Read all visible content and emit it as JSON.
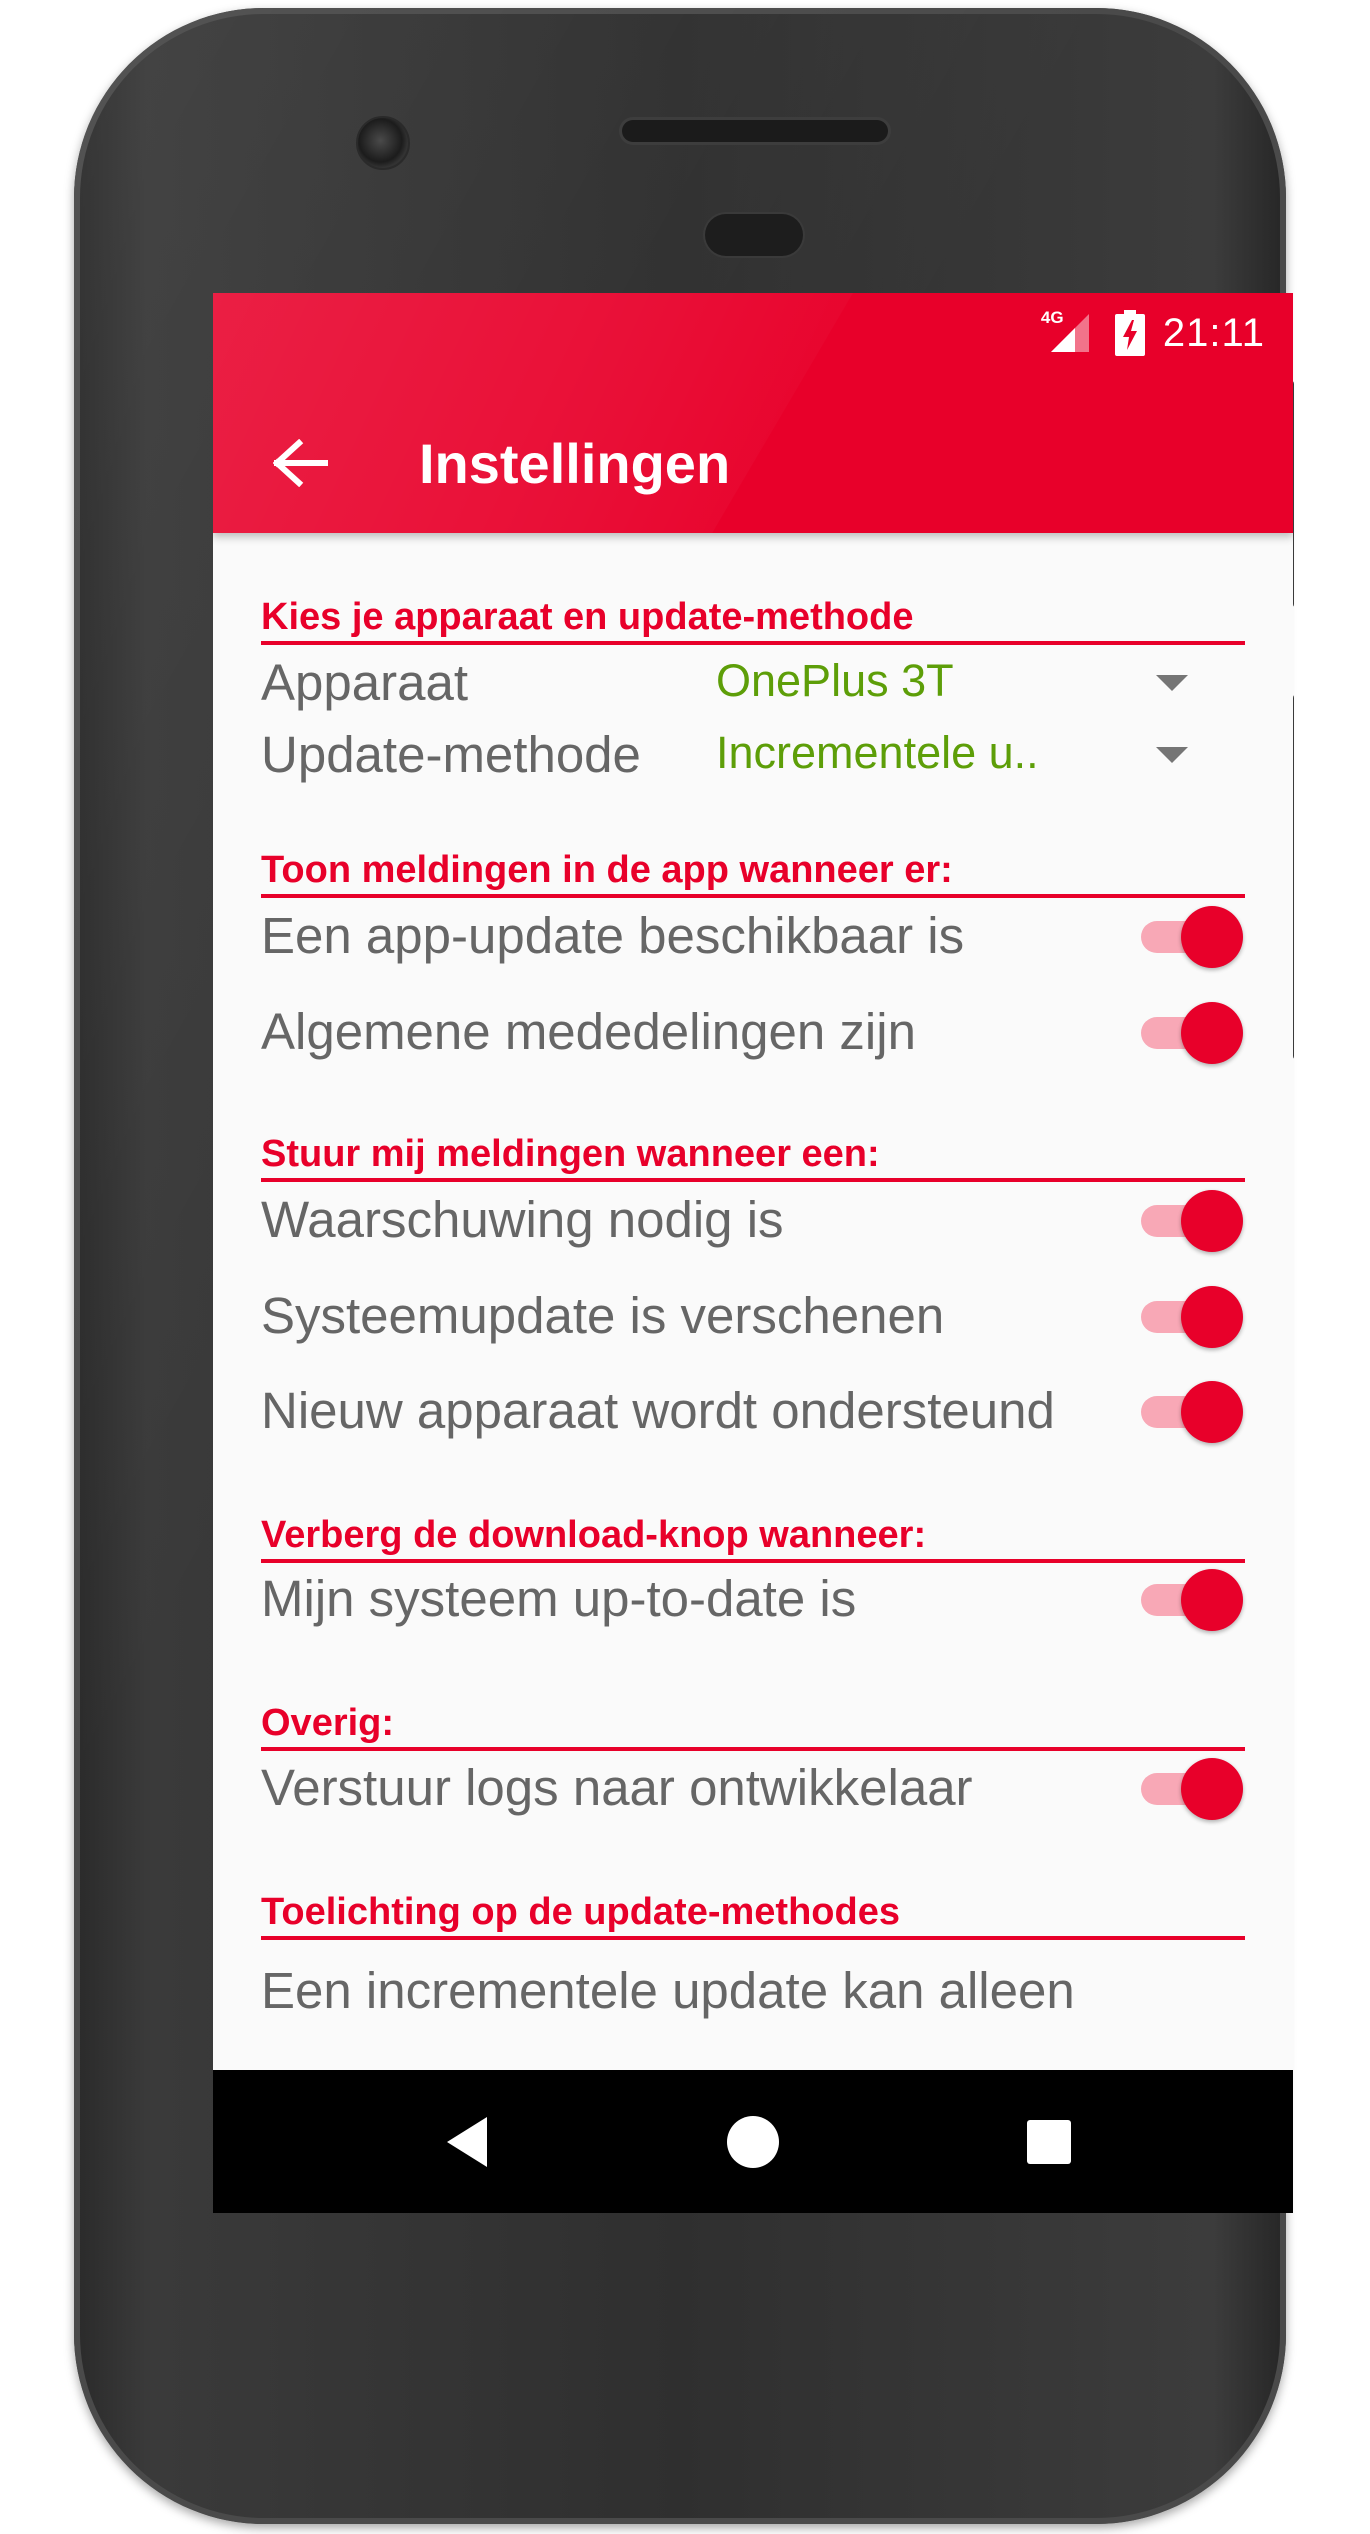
{
  "status_bar": {
    "network": "4G",
    "time": "21:11"
  },
  "app_bar": {
    "title": "Instellingen",
    "back_icon": "arrow-left-icon"
  },
  "sections": {
    "device": {
      "header": "Kies je apparaat en update-methode",
      "device_label": "Apparaat",
      "device_value": "OnePlus 3T",
      "method_label": "Update-methode",
      "method_value": "Incrementele u.."
    },
    "in_app": {
      "header": "Toon meldingen in de app wanneer er:",
      "items": [
        {
          "label": "Een app-update beschikbaar is",
          "on": true
        },
        {
          "label": "Algemene mededelingen zijn",
          "on": true
        }
      ]
    },
    "push": {
      "header": "Stuur mij meldingen wanneer een:",
      "items": [
        {
          "label": "Waarschuwing nodig is",
          "on": true
        },
        {
          "label": "Systeemupdate is verschenen",
          "on": true
        },
        {
          "label": "Nieuw apparaat wordt ondersteund",
          "on": true
        }
      ]
    },
    "download": {
      "header": "Verberg de download-knop wanneer:",
      "items": [
        {
          "label": "Mijn systeem up-to-date is",
          "on": true
        }
      ]
    },
    "other": {
      "header": "Overig:",
      "items": [
        {
          "label": "Verstuur logs naar ontwikkelaar",
          "on": true
        }
      ]
    },
    "explanation": {
      "header": "Toelichting op de update-methodes",
      "text": "Een incrementele update kan alleen"
    }
  },
  "nav_bar": {
    "icons": [
      "back-triangle-icon",
      "home-circle-icon",
      "recents-square-icon"
    ]
  },
  "colors": {
    "accent": "#e8002a",
    "value_green": "#5d9e08",
    "label_gray": "#666666"
  }
}
